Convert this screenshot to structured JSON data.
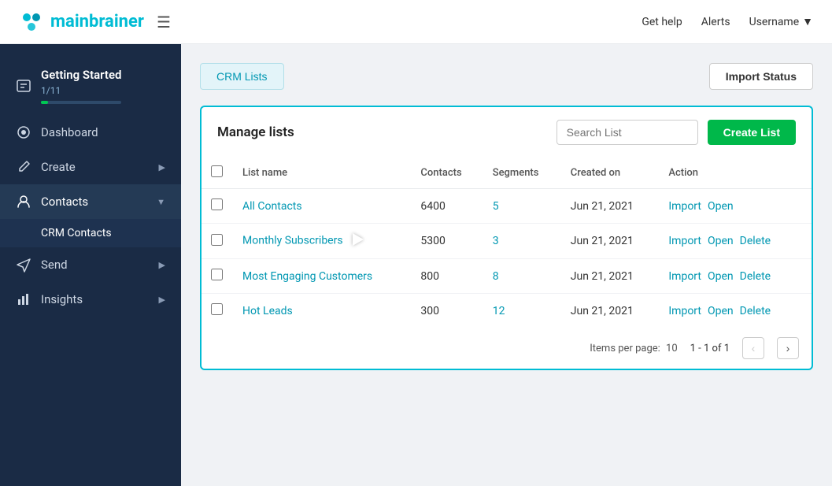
{
  "app": {
    "name_part1": "main",
    "name_part2": "brainer"
  },
  "topnav": {
    "get_help": "Get help",
    "alerts": "Alerts",
    "username": "Username"
  },
  "sidebar": {
    "getting_started": "Getting Started",
    "progress_label": "1/11",
    "progress_percent": 9,
    "items": [
      {
        "id": "dashboard",
        "label": "Dashboard",
        "icon": "dashboard",
        "has_arrow": false
      },
      {
        "id": "create",
        "label": "Create",
        "icon": "create",
        "has_arrow": true
      },
      {
        "id": "contacts",
        "label": "Contacts",
        "icon": "contacts",
        "has_arrow": true,
        "active": true
      },
      {
        "id": "send",
        "label": "Send",
        "icon": "send",
        "has_arrow": true
      },
      {
        "id": "insights",
        "label": "Insights",
        "icon": "insights",
        "has_arrow": true
      }
    ],
    "sub_items": [
      {
        "id": "crm-contacts",
        "label": "CRM Contacts",
        "active": true
      }
    ]
  },
  "tabs": {
    "crm_lists": "CRM Lists",
    "import_status": "Import Status"
  },
  "manage_lists": {
    "title": "Manage lists",
    "search_placeholder": "Search List",
    "create_button": "Create List"
  },
  "table": {
    "columns": [
      "",
      "List name",
      "Contacts",
      "Segments",
      "Created on",
      "Action"
    ],
    "rows": [
      {
        "name": "All Contacts",
        "contacts": "6400",
        "segments": "5",
        "created": "Jun 21, 2021",
        "actions": [
          "Import",
          "Open"
        ],
        "deletable": false
      },
      {
        "name": "Monthly Subscribers",
        "contacts": "5300",
        "segments": "3",
        "created": "Jun 21, 2021",
        "actions": [
          "Import",
          "Open",
          "Delete"
        ],
        "deletable": true
      },
      {
        "name": "Most Engaging Customers",
        "contacts": "800",
        "segments": "8",
        "created": "Jun 21, 2021",
        "actions": [
          "Import",
          "Open",
          "Delete"
        ],
        "deletable": true
      },
      {
        "name": "Hot Leads",
        "contacts": "300",
        "segments": "12",
        "created": "Jun 21, 2021",
        "actions": [
          "Import",
          "Open",
          "Delete"
        ],
        "deletable": true
      }
    ]
  },
  "pagination": {
    "items_per_page_label": "Items per page:",
    "items_per_page": "10",
    "range": "1 - 1 of 1"
  }
}
